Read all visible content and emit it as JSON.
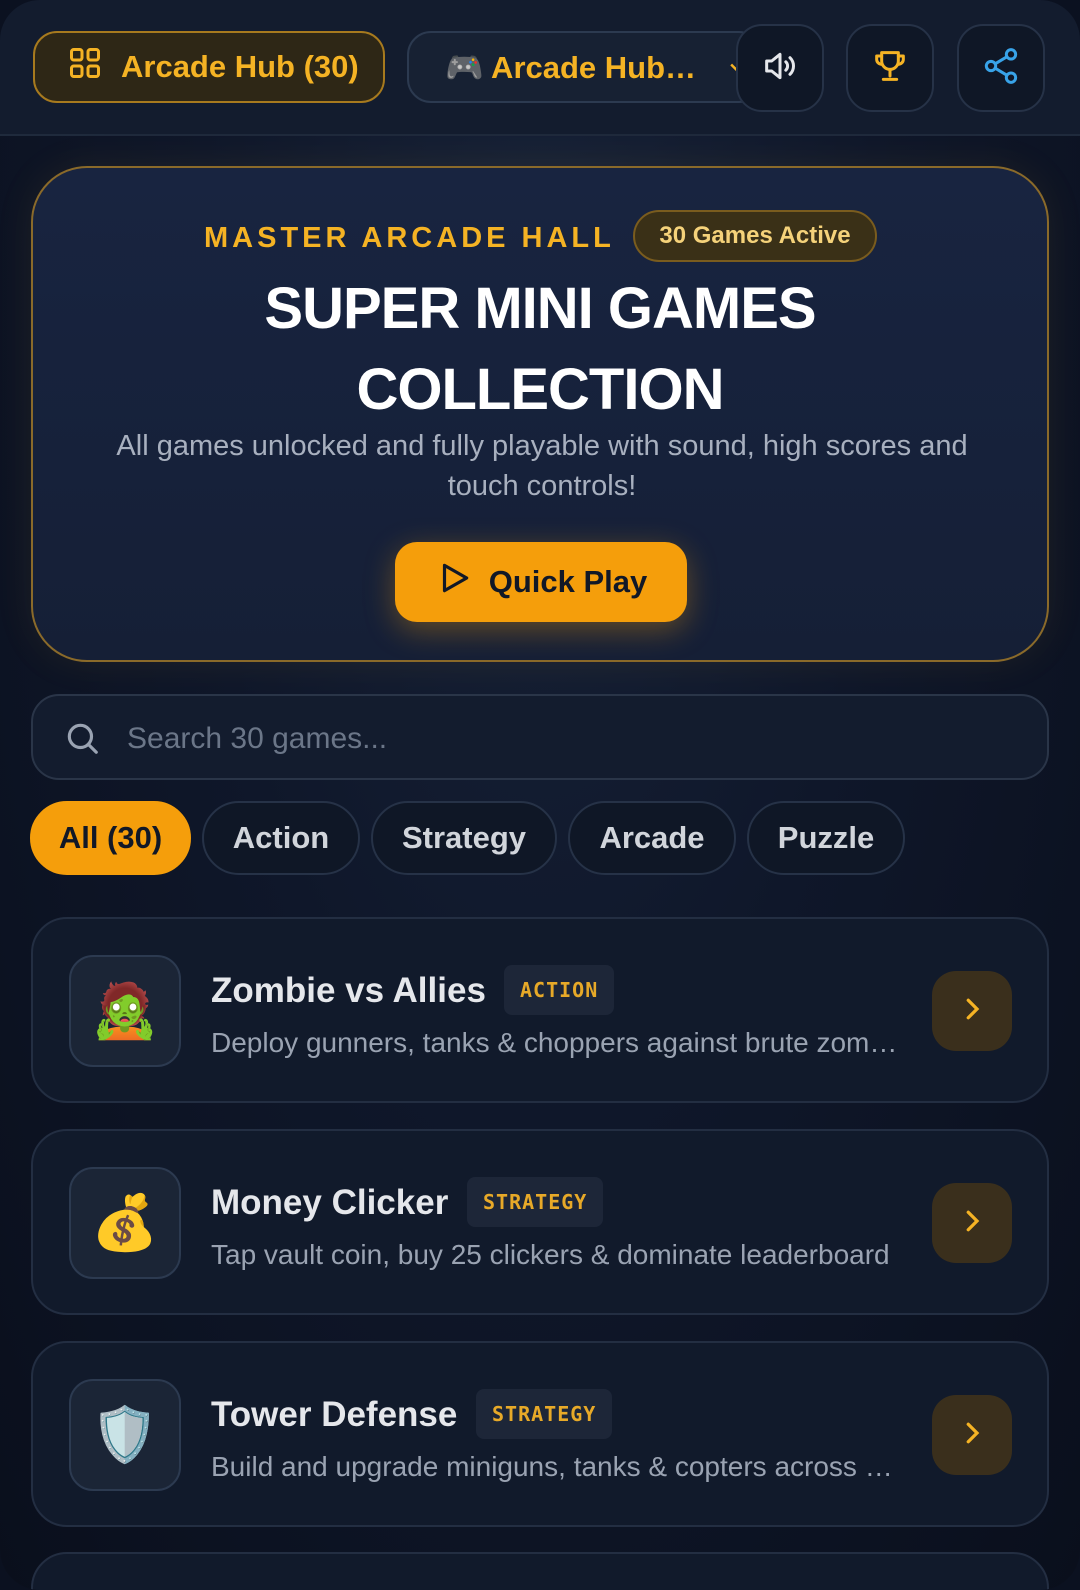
{
  "topbar": {
    "hub_button": "Arcade Hub (30)",
    "game_select": {
      "selected": "🎮 Arcade Hub…"
    },
    "icons": [
      "grid-icon",
      "speaker-icon",
      "trophy-icon",
      "share-icon"
    ]
  },
  "hero": {
    "eyebrow": "MASTER ARCADE HALL",
    "badge": "30 Games Active",
    "title_line1": "SUPER MINI GAMES",
    "title_line2": "COLLECTION",
    "subtitle": "All games unlocked and fully playable with sound, high scores and touch controls!",
    "cta": "Quick Play"
  },
  "search": {
    "placeholder": "Search 30 games..."
  },
  "filters": [
    {
      "label": "All (30)",
      "active": true
    },
    {
      "label": "Action",
      "active": false
    },
    {
      "label": "Strategy",
      "active": false
    },
    {
      "label": "Arcade",
      "active": false
    },
    {
      "label": "Puzzle",
      "active": false
    }
  ],
  "games": [
    {
      "emoji": "🧟",
      "title": "Zombie vs Allies",
      "tag": "ACTION",
      "desc": "Deploy gunners, tanks & choppers against brute zombies"
    },
    {
      "emoji": "💰",
      "title": "Money Clicker",
      "tag": "STRATEGY",
      "desc": "Tap vault coin, buy 25 clickers & dominate leaderboard"
    },
    {
      "emoji": "🛡️",
      "title": "Tower Defense",
      "tag": "STRATEGY",
      "desc": "Build and upgrade miniguns, tanks & copters across rounds"
    }
  ],
  "colors": {
    "accent": "#f59e0b",
    "accent_text": "#f5b324",
    "background": "#0f172a"
  }
}
